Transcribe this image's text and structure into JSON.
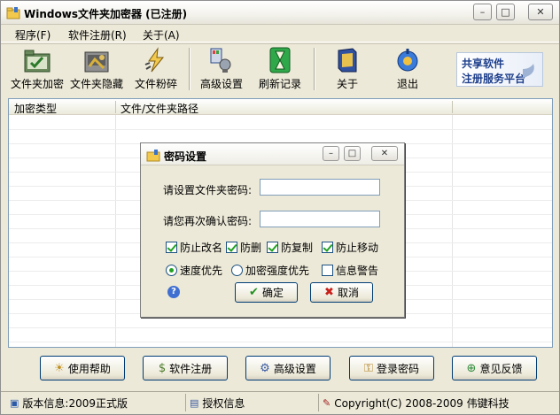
{
  "window": {
    "title": "Windows文件夹加密器 (已注册)"
  },
  "title_buttons": {
    "minimize": "–",
    "maximize": "□",
    "close": "✕"
  },
  "menubar": [
    {
      "label": "程序(F)"
    },
    {
      "label": "软件注册(R)"
    },
    {
      "label": "关于(A)"
    }
  ],
  "toolbar": [
    {
      "label": "文件夹加密",
      "icon": "folder-encrypt-icon"
    },
    {
      "label": "文件夹隐藏",
      "icon": "folder-hide-icon"
    },
    {
      "label": "文件粉碎",
      "icon": "file-shred-icon"
    },
    {
      "label": "高级设置",
      "icon": "advanced-settings-icon"
    },
    {
      "label": "刷新记录",
      "icon": "hourglass-icon"
    },
    {
      "label": "关于",
      "icon": "book-icon"
    },
    {
      "label": "退出",
      "icon": "exit-icon"
    }
  ],
  "share_badge": {
    "line1": "共享软件",
    "line2": "注册服务平台"
  },
  "list": {
    "columns": [
      "加密类型",
      "文件/文件夹路径"
    ]
  },
  "dialog": {
    "title": "密码设置",
    "password_label": "请设置文件夹密码:",
    "password_value": "",
    "confirm_label": "请您再次确认密码:",
    "confirm_value": "",
    "checkboxes": [
      {
        "label": "防止改名",
        "checked": true
      },
      {
        "label": "防删",
        "checked": true
      },
      {
        "label": "防复制",
        "checked": true
      },
      {
        "label": "防止移动",
        "checked": true
      }
    ],
    "radios": [
      {
        "label": "速度优先",
        "selected": true
      },
      {
        "label": "加密强度优先",
        "selected": false
      }
    ],
    "info_warning": {
      "label": "信息警告",
      "checked": false
    },
    "ok_label": "确定",
    "cancel_label": "取消"
  },
  "bottom_buttons": [
    {
      "label": "使用帮助"
    },
    {
      "label": "软件注册"
    },
    {
      "label": "高级设置"
    },
    {
      "label": "登录密码"
    },
    {
      "label": "意见反馈"
    }
  ],
  "status": {
    "version": "版本信息:2009正式版",
    "license": "授权信息",
    "copyright": "Copyright(C) 2008-2009 伟键科技"
  },
  "colors": {
    "window_bg": "#ece9d8",
    "accent_blue": "#1e3f8c",
    "check_green": "#21a121"
  }
}
